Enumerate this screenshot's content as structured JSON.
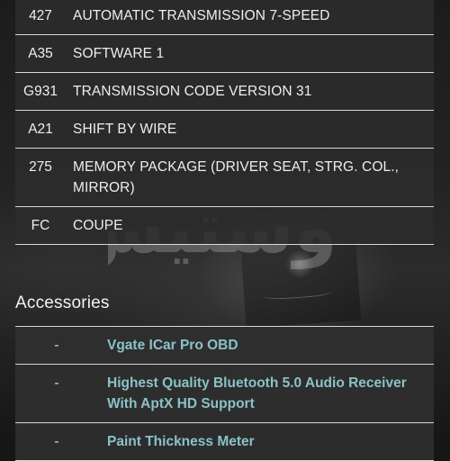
{
  "options": [
    {
      "code": "427",
      "description": "AUTOMATIC TRANSMISSION 7-SPEED"
    },
    {
      "code": "A35",
      "description": "SOFTWARE 1"
    },
    {
      "code": "G931",
      "description": "TRANSMISSION CODE VERSION 31"
    },
    {
      "code": "A21",
      "description": "SHIFT BY WIRE"
    },
    {
      "code": "275",
      "description": "MEMORY PACKAGE (DRIVER SEAT, STRG. COL., MIRROR)"
    },
    {
      "code": "FC",
      "description": "COUPE"
    }
  ],
  "accessories": {
    "title": "Accessories",
    "items": [
      {
        "marker": "-",
        "name": "Vgate ICar Pro OBD"
      },
      {
        "marker": "-",
        "name": "Highest Quality Bluetooth 5.0 Audio Receiver With AptX HD Support"
      },
      {
        "marker": "-",
        "name": "Paint Thickness Meter"
      }
    ]
  },
  "watermark": {
    "text": "دوستیس"
  },
  "colors": {
    "row_background": "#2c2c2c",
    "row_text": "#eeeeee",
    "divider": "#d8d8d8",
    "link": "#8ac2c8",
    "page_background": "#161616"
  }
}
